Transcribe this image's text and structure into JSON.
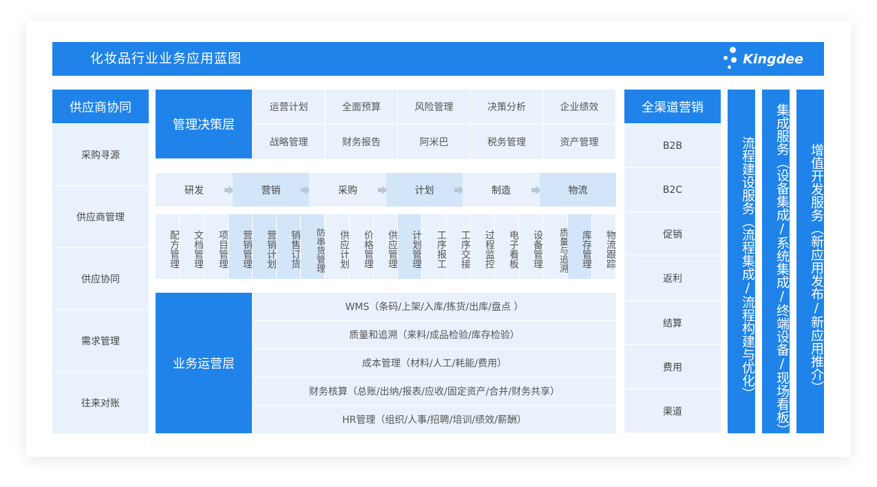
{
  "header": {
    "title": "化妆品行业业务应用蓝图",
    "logo_text": "Kingdee"
  },
  "supplier": {
    "title": "供应商协同",
    "items": [
      "采购寻源",
      "供应商管理",
      "供应协同",
      "需求管理",
      "往来对账"
    ]
  },
  "mgmt": {
    "title": "管理决策层",
    "row1": [
      "运营计划",
      "全面预算",
      "风险管理",
      "决策分析",
      "企业绩效"
    ],
    "row2": [
      "战略管理",
      "财务报告",
      "阿米巴",
      "税务管理",
      "资产管理"
    ]
  },
  "flow": {
    "steps": [
      "研发",
      "营销",
      "采购",
      "计划",
      "制造",
      "物流"
    ]
  },
  "modules": [
    "配方管理",
    "文档管理",
    "项目管理",
    "营销管理",
    "营销计划",
    "销售订货",
    "防串货管理",
    "供应计划",
    "价格管理",
    "供应管理",
    "计划管理",
    "工序报工",
    "工序交接",
    "过程监控",
    "电子看板",
    "设备管理",
    "质量与追溯",
    "库存管理",
    "物流跟踪"
  ],
  "ops": {
    "title": "业务运营层",
    "rows": [
      "WMS（条码/上架/入库/拣货/出库/盘点 ）",
      "质量和追溯（来料/成品检验/库存检验）",
      "成本管理（材料/人工/耗能/费用）",
      "财务核算（总账/出纳/报表/应收/固定资产/合并/财务共享）",
      "HR管理（组织/人事/招聘/培训/绩效/薪酬）"
    ]
  },
  "channel": {
    "title": "全渠道营销",
    "items": [
      "B2B",
      "B2C",
      "促销",
      "返利",
      "结算",
      "费用",
      "渠道"
    ]
  },
  "services": [
    "流程建设服务（流程集成/流程构建与优化）",
    "集成服务（设备集成/系统集成/终端设备/现场看板）",
    "增值开发服务（新应用发布/新应用推介）"
  ]
}
